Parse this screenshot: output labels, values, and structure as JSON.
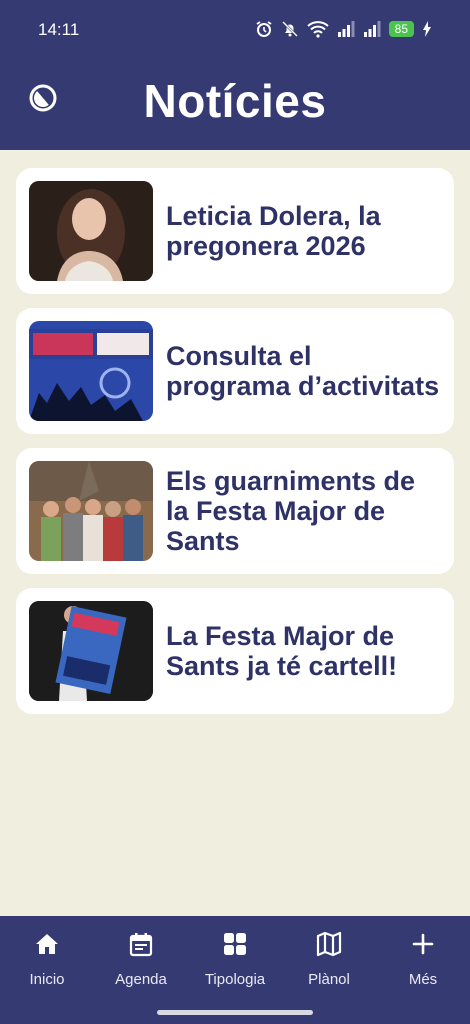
{
  "status_bar": {
    "time": "14:11",
    "battery": "85",
    "icons": [
      "alarm-icon",
      "bell-off-icon",
      "wifi-icon",
      "signal-icon",
      "signal-icon",
      "charging-icon"
    ]
  },
  "header": {
    "title": "Notícies",
    "theme_icon": "half-moon-icon"
  },
  "news": [
    {
      "title": "Leticia Dolera, la pregonera 2026"
    },
    {
      "title": "Consulta el programa d’activitats"
    },
    {
      "title": "Els guarniments de la Festa Major de Sants"
    },
    {
      "title": "La Festa Major de Sants ja té cartell!"
    }
  ],
  "bottom_nav": [
    {
      "label": "Inicio",
      "icon": "home-icon"
    },
    {
      "label": "Agenda",
      "icon": "calendar-icon"
    },
    {
      "label": "Tipologia",
      "icon": "grid-icon"
    },
    {
      "label": "Plànol",
      "icon": "map-icon"
    },
    {
      "label": "Més",
      "icon": "plus-icon"
    }
  ],
  "colors": {
    "header": "#363a73",
    "background": "#f0eedf",
    "card": "#ffffff",
    "card_title": "#2f3266",
    "battery": "#4cc34f"
  }
}
